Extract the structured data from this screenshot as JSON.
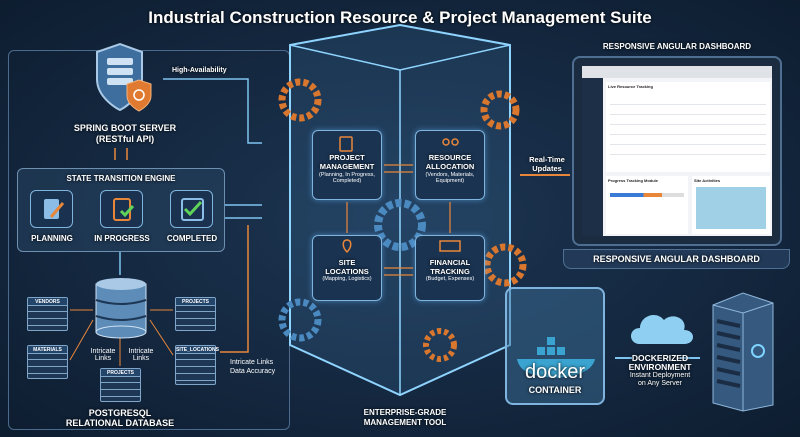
{
  "title": "Industrial Construction Resource & Project Management Suite",
  "server": {
    "name": "SPRING BOOT SERVER",
    "sub": "(RESTful API)",
    "link": "High-Availability"
  },
  "engine": {
    "title": "STATE TRANSITION ENGINE",
    "states": [
      "PLANNING",
      "IN PROGRESS",
      "COMPLETED"
    ]
  },
  "database": {
    "tables": [
      "VENDORS",
      "MATERIALS",
      "PROJECTS",
      "SITE_LOCATIONS",
      "PROJECTS"
    ],
    "links": [
      "Intricate Links",
      "Intricate Links"
    ],
    "title": "POSTGRESQL",
    "subtitle": "RELATIONAL DATABASE",
    "side_link_1": "Intricate Links",
    "side_link_2": "Data Accuracy"
  },
  "core": {
    "modules": [
      {
        "title1": "PROJECT",
        "title2": "MANAGEMENT",
        "desc": "(Planning, In Progress, Completed)"
      },
      {
        "title1": "RESOURCE",
        "title2": "ALLOCATION",
        "desc": "(Vendors, Materials, Equipment)"
      },
      {
        "title1": "SITE",
        "title2": "LOCATIONS",
        "desc": "(Mapping, Logistics)"
      },
      {
        "title1": "FINANCIAL",
        "title2": "TRACKING",
        "desc": "(Budget, Expenses)"
      }
    ],
    "caption1": "ENTERPRISE-GRADE",
    "caption2": "MANAGEMENT TOOL"
  },
  "realtime": {
    "l1": "Real-Time",
    "l2": "Updates"
  },
  "dashboard": {
    "heading": "RESPONSIVE ANGULAR DASHBOARD",
    "footer": "RESPONSIVE ANGULAR DASHBOARD",
    "table_title": "Live Resource Tracking",
    "progress_title": "Progress Tracking Module",
    "map_title": "Site Activities"
  },
  "docker": {
    "logo": "docker",
    "label": "CONTAINER"
  },
  "deploy": {
    "title1": "DOCKERIZED",
    "title2": "ENVIRONMENT",
    "sub1": "Instant Deployment",
    "sub2": "on Any Server"
  },
  "colors": {
    "accent_orange": "#e8873a",
    "accent_blue": "#7fc4f0"
  }
}
